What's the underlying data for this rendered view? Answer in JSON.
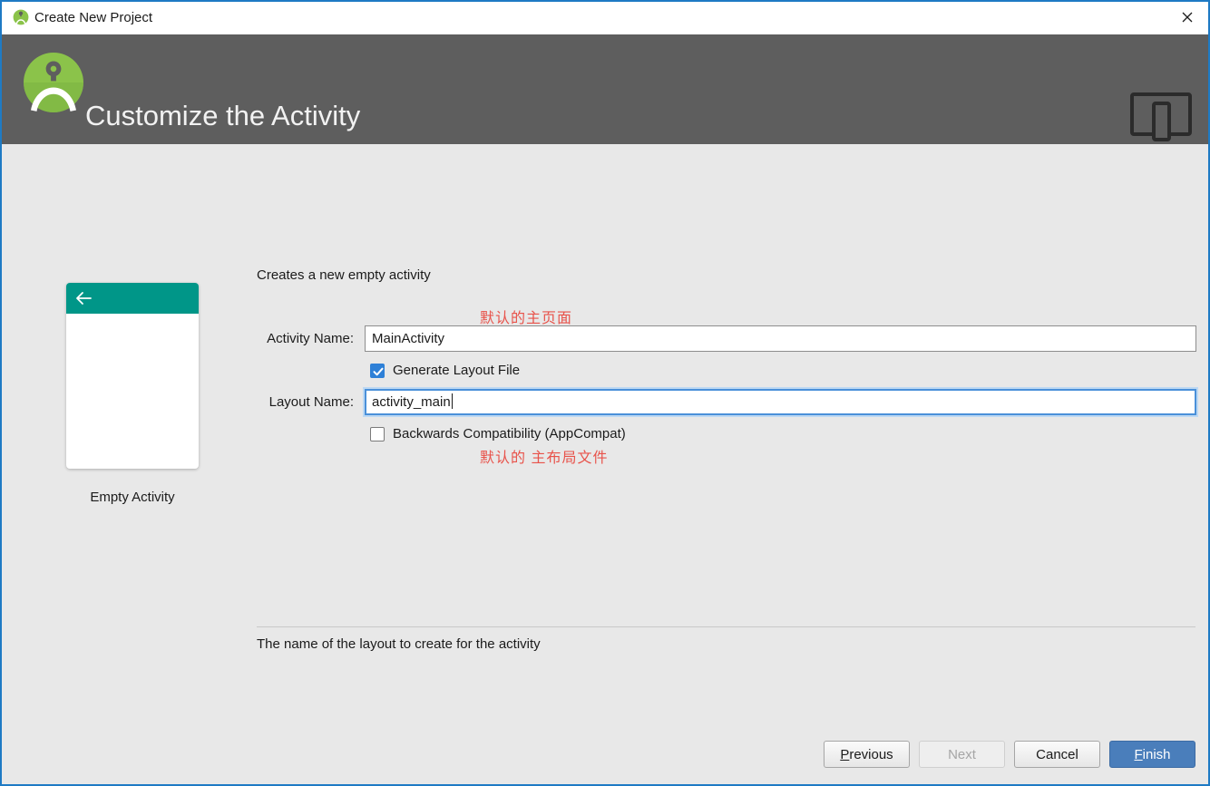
{
  "window": {
    "title": "Create New Project",
    "title_icon": "android-studio-icon",
    "close_icon": "close-icon"
  },
  "header": {
    "title": "Customize the Activity",
    "logo_icon": "android-studio-logo",
    "device_icon": "tablet-device-icon"
  },
  "preview": {
    "label": "Empty Activity",
    "appbar_color": "#009688",
    "back_icon": "back-arrow-icon"
  },
  "form": {
    "description": "Creates a new empty activity",
    "activity_name": {
      "label": "Activity Name:",
      "value": "MainActivity"
    },
    "generate_layout": {
      "label": "Generate Layout File",
      "checked": true
    },
    "layout_name": {
      "label": "Layout Name:",
      "value": "activity_main",
      "focused": true
    },
    "backwards_compat": {
      "label": "Backwards Compatibility (AppCompat)",
      "checked": false
    },
    "hint": "The name of the layout to create for the activity"
  },
  "annotations": {
    "color": "#e8524a",
    "activity_note": "默认的主页面",
    "layout_note": "默认的 主布局文件"
  },
  "footer": {
    "previous": {
      "prefix": "P",
      "rest": "revious"
    },
    "next": "Next",
    "cancel": "Cancel",
    "finish": {
      "prefix": "F",
      "rest": "inish"
    }
  }
}
